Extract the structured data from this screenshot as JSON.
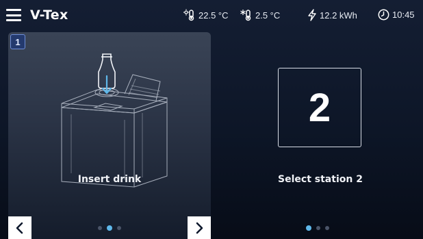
{
  "header": {
    "title": "V-Tex",
    "heat_temp": "22.5 °C",
    "cool_temp": "2.5 °C",
    "energy": "12.2 kWh",
    "time": "10:45"
  },
  "step_card": {
    "step_number": "1",
    "caption": "Insert drink",
    "pager": {
      "count": 3,
      "active_index": 1
    }
  },
  "station_panel": {
    "station_number": "2",
    "caption": "Select station 2",
    "pager": {
      "count": 3,
      "active_index": 0
    }
  },
  "icons": {
    "menu": "hamburger-icon",
    "heat": "thermometer-heat-icon",
    "cool": "thermometer-snowflake-icon",
    "energy": "lightning-icon",
    "time": "clock-icon",
    "prev": "chevron-left-icon",
    "next": "chevron-right-icon"
  },
  "colors": {
    "accent": "#5fb8ea",
    "badge_border": "#6f8fd8",
    "background": "#0d1627"
  }
}
